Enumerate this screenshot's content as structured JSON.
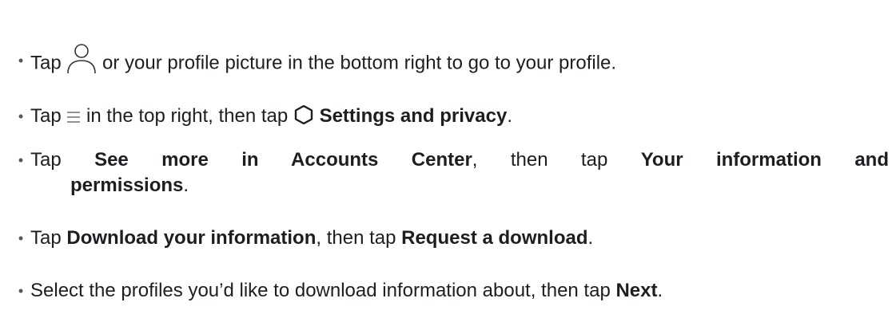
{
  "steps": [
    {
      "bullet": "•",
      "parts": {
        "a": "Tap ",
        "icon": "profile-icon",
        "b": " or your profile picture in the bottom right to go to your profile."
      }
    },
    {
      "bullet": "•",
      "parts": {
        "a": "Tap ",
        "icon": "menu-icon",
        "b": " in the top right, then tap ",
        "icon2": "settings-icon",
        "c_bold": "Settings and privacy",
        "d": "."
      }
    },
    {
      "bullet": "•",
      "parts": {
        "a": "Tap ",
        "b_bold": "See more in Accounts Center",
        "c": ", then tap ",
        "d_bold": "Your information and",
        "e_bold": "permissions",
        "f": "."
      }
    },
    {
      "bullet": "•",
      "parts": {
        "a": "Tap ",
        "b_bold": "Download your information",
        "c": ", then tap ",
        "d_bold": "Request a download",
        "e": "."
      }
    },
    {
      "bullet": "•",
      "parts": {
        "a": "Select the profiles you’d like to download information about, then tap ",
        "b_bold": "Next",
        "c": "."
      }
    }
  ]
}
